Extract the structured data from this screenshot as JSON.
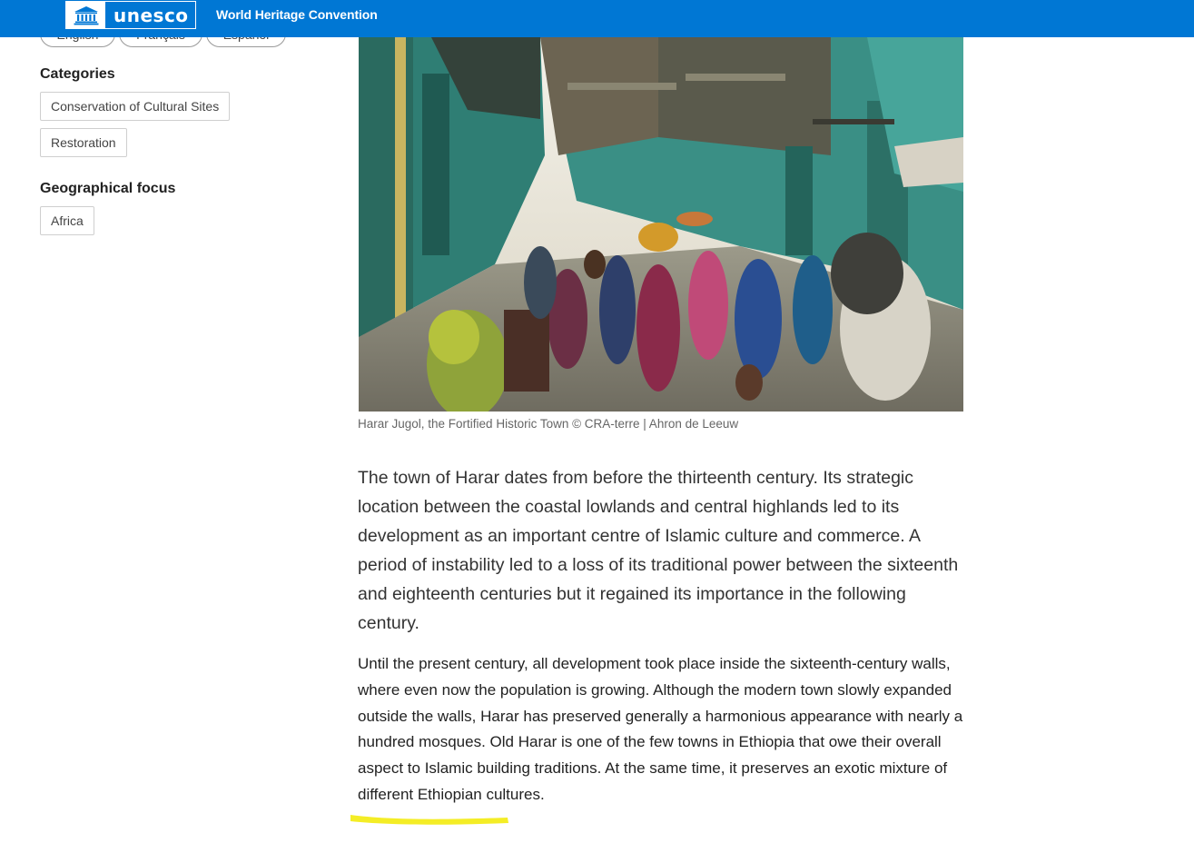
{
  "header": {
    "logo_text": "unesco",
    "title": "World Heritage Convention",
    "logo_icon": "unesco-temple-icon",
    "background_color": "#0077d4"
  },
  "languages": [
    "English",
    "Français",
    "Español"
  ],
  "sidebar": {
    "categories_heading": "Categories",
    "categories": [
      "Conservation of Cultural Sites",
      "Restoration"
    ],
    "geo_heading": "Geographical focus",
    "geo": [
      "Africa"
    ]
  },
  "main": {
    "caption": "Harar Jugol, the Fortified Historic Town © CRA-terre | Ahron de Leeuw",
    "lead": "The town of Harar dates from before the thirteenth century. Its strategic location between the coastal lowlands and central highlands led to its development as an important centre of Islamic culture and commerce. A period of instability led to a loss of its traditional power between the sixteenth and eighteenth centuries but it regained its importance in the following century.",
    "body_main": "Until the present century, all development took place inside the sixteenth-century walls, where even now the population is growing. Although the modern town slowly expanded outside the walls, Harar has preserved generally a harmonious appearance with nearly a hundred mosques. Old Harar is one of the few towns in Ethiopia that owe their overall aspect to Islamic building traditions. At the same time, it preserves an exotic mixture of different ",
    "body_highlight": "Ethiopian cultures.",
    "highlight_color": "#f2ea00"
  }
}
